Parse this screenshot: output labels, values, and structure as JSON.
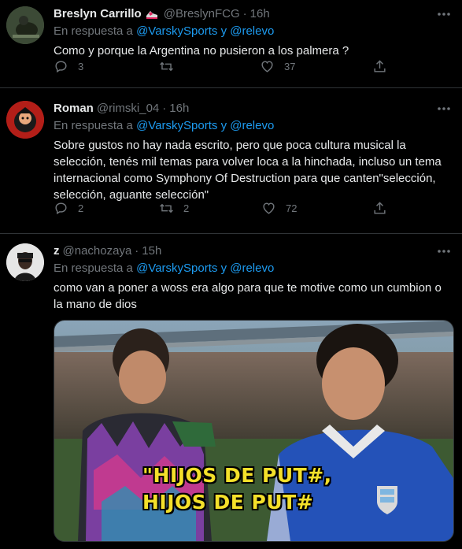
{
  "tweets": [
    {
      "name": "Breslyn Carrillo",
      "handle": "@BreslynFCG",
      "time": "16h",
      "reply_prefix": "En respuesta a",
      "reply_user1": "@VarskySports",
      "reply_join": "y",
      "reply_user2": "@relevo",
      "text": "Como y porque la Argentina no pusieron a los palmera ?",
      "replies": "3",
      "retweets": "",
      "likes": "37"
    },
    {
      "name": "Roman",
      "handle": "@rimski_04",
      "time": "16h",
      "reply_prefix": "En respuesta a",
      "reply_user1": "@VarskySports",
      "reply_join": "y",
      "reply_user2": "@relevo",
      "text": "Sobre gustos no hay nada escrito, pero que poca cultura musical la selección, tenés mil temas para volver loca a la hinchada, incluso un tema internacional como Symphony Of Destruction para que canten\"selección, selección, aguante selección\"",
      "replies": "2",
      "retweets": "2",
      "likes": "72"
    },
    {
      "name": "z",
      "handle": "@nachozaya",
      "time": "15h",
      "reply_prefix": "En respuesta a",
      "reply_user1": "@VarskySports",
      "reply_join": "y",
      "reply_user2": "@relevo",
      "text": "como van a poner a woss era algo para que te motive como un cumbion o la mano de dios",
      "media_caption_line1": "\"HIJOS DE PUT#,",
      "media_caption_line2": "HIJOS DE PUT#"
    }
  ],
  "icons": {
    "reply": "reply-icon",
    "retweet": "retweet-icon",
    "like": "heart-icon",
    "share": "share-icon",
    "more": "more-icon"
  },
  "colors": {
    "background": "#000000",
    "text": "#e7e9ea",
    "muted": "#71767b",
    "link": "#1d9bf0",
    "divider": "#2f3336",
    "caption": "#f4e02a"
  }
}
